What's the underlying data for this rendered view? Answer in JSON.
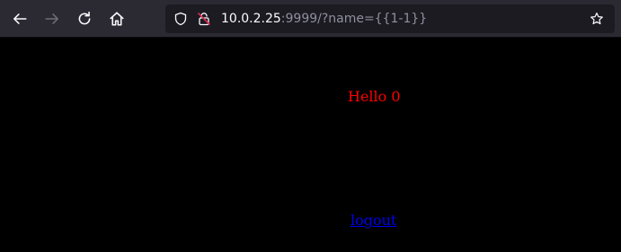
{
  "browser": {
    "url_host": "10.0.2.25",
    "url_rest": ":9999/?name={{1-1}}"
  },
  "page": {
    "greeting": "Hello 0",
    "logout_link": "logout"
  }
}
